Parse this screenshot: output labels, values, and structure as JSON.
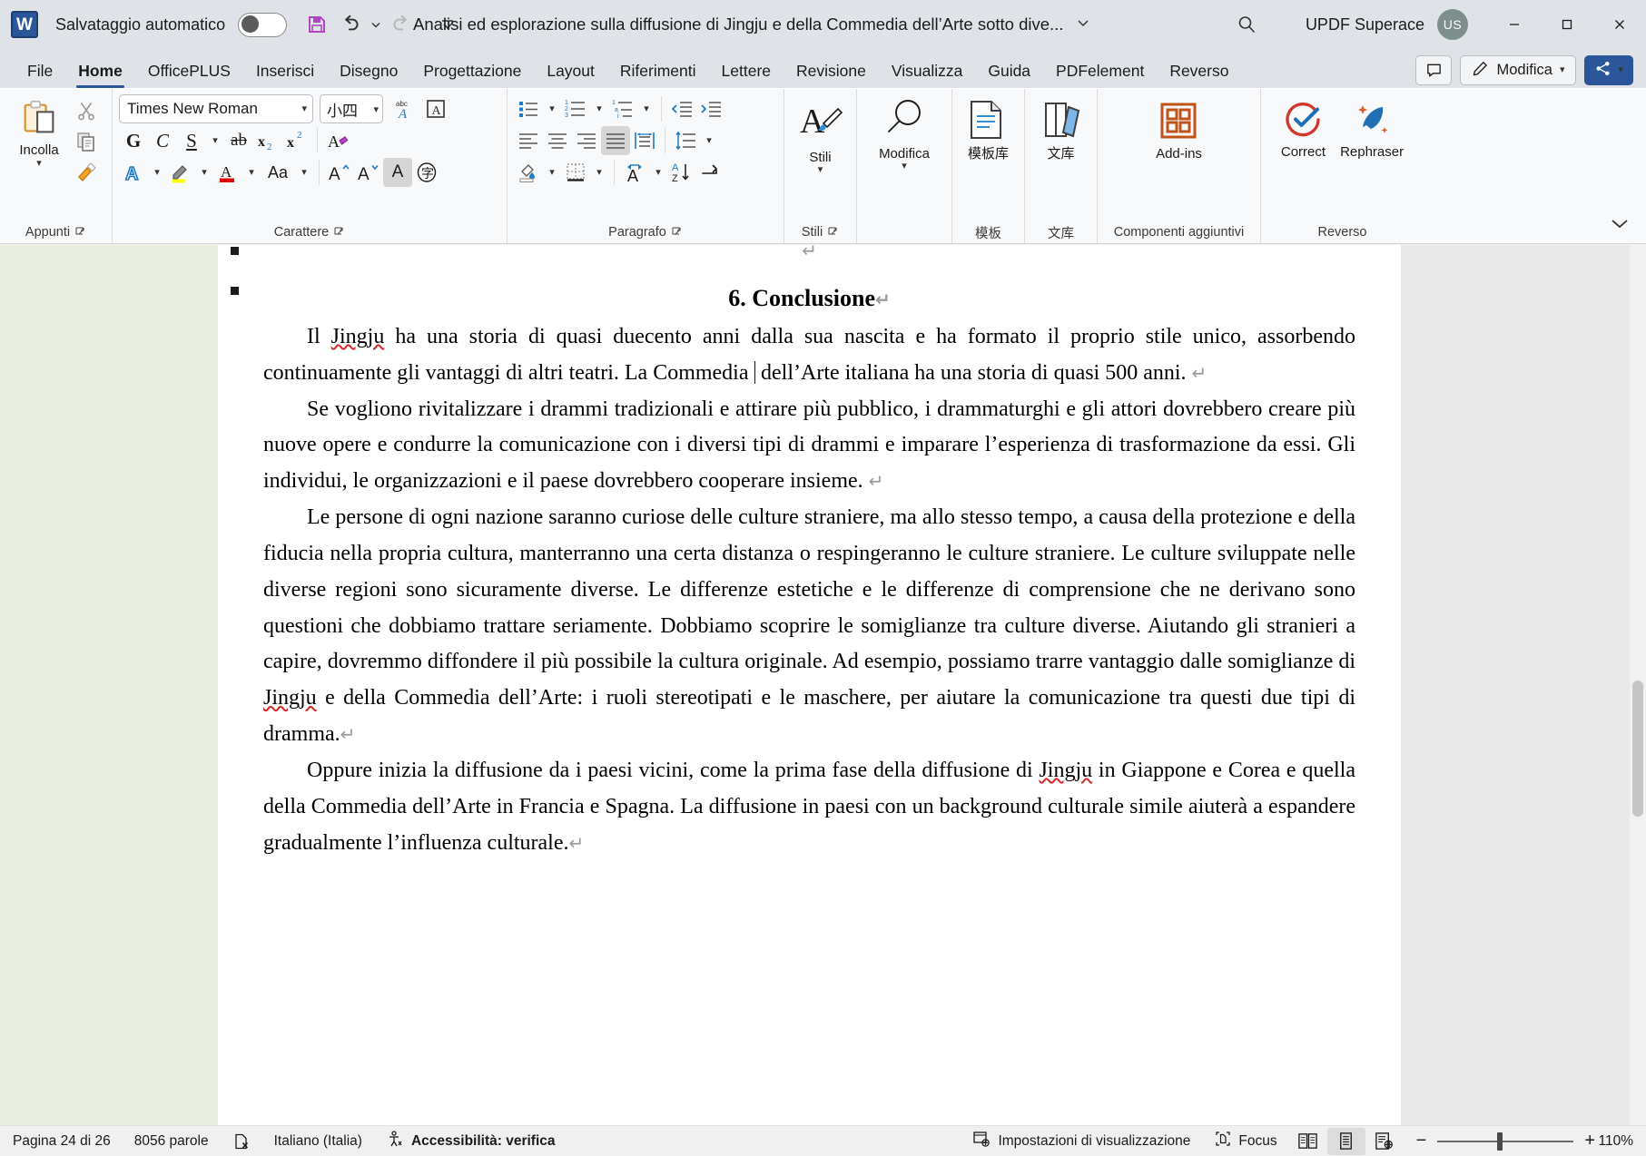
{
  "titlebar": {
    "app_icon": "word-icon",
    "autosave_label": "Salvataggio automatico",
    "autosave_state": "off",
    "quick_access": [
      {
        "name": "save-icon",
        "label": "Salva"
      },
      {
        "name": "undo-icon",
        "label": "Annulla"
      },
      {
        "name": "redo-icon",
        "label": "Ripeti"
      },
      {
        "name": "customize-qat-icon",
        "label": "Personalizza barra di accesso rapido"
      }
    ],
    "document_title": "Analisi ed esplorazione sulla diffusione di Jingju e della Commedia dell’Arte sotto dive...",
    "search_icon": "search-icon",
    "account_name": "UPDF Superace",
    "avatar_initials": "US",
    "window_controls": [
      "minimize",
      "maximize",
      "close"
    ]
  },
  "tabs": [
    {
      "label": "File",
      "active": false
    },
    {
      "label": "Home",
      "active": true
    },
    {
      "label": "OfficePLUS",
      "active": false
    },
    {
      "label": "Inserisci",
      "active": false
    },
    {
      "label": "Disegno",
      "active": false
    },
    {
      "label": "Progettazione",
      "active": false
    },
    {
      "label": "Layout",
      "active": false
    },
    {
      "label": "Riferimenti",
      "active": false
    },
    {
      "label": "Lettere",
      "active": false
    },
    {
      "label": "Revisione",
      "active": false
    },
    {
      "label": "Visualizza",
      "active": false
    },
    {
      "label": "Guida",
      "active": false
    },
    {
      "label": "PDFelement",
      "active": false
    },
    {
      "label": "Reverso",
      "active": false
    }
  ],
  "tabbar_right": {
    "comment_icon": "comment-icon",
    "edit_mode_label": "Modifica",
    "edit_mode_icon": "pencil-icon",
    "share_icon": "share-icon"
  },
  "ribbon": {
    "groups": [
      {
        "name": "clipboard",
        "label": "Appunti",
        "has_dialog_launcher": true,
        "paste_label": "Incolla",
        "buttons": [
          "cut-icon",
          "copy-icon",
          "format-painter-icon"
        ]
      },
      {
        "name": "font",
        "label": "Carattere",
        "has_dialog_launcher": true,
        "font_name": "Times New Roman",
        "font_size": "小四",
        "buttons": [
          "bold-G",
          "italic-C",
          "underline-S",
          "strikethrough-ab",
          "subscript-x2",
          "superscript-x2",
          "clear-formatting-icon",
          "text-effects-icon",
          "highlight-icon",
          "font-color-icon",
          "change-case-Aa",
          "grow-font-icon",
          "shrink-font-icon",
          "character-shading-icon",
          "enclose-character-icon",
          "phonetic-guide-icon",
          "character-border-icon"
        ]
      },
      {
        "name": "paragraph",
        "label": "Paragrafo",
        "has_dialog_launcher": true,
        "buttons": [
          "bullets-icon",
          "numbering-icon",
          "multilevel-list-icon",
          "decrease-indent-icon",
          "increase-indent-icon",
          "align-left-icon",
          "align-center-icon",
          "align-right-icon",
          "justify-icon",
          "distribute-icon",
          "line-spacing-icon",
          "shading-icon",
          "borders-icon",
          "asian-layout-icon",
          "sort-icon",
          "show-formatting-marks-icon"
        ],
        "active_button": "justify-icon"
      },
      {
        "name": "styles",
        "label": "Stili",
        "has_dialog_launcher": true,
        "button_label": "Stili"
      },
      {
        "name": "editing",
        "label": "",
        "has_dialog_launcher": false,
        "button_label": "Modifica"
      },
      {
        "name": "template",
        "label": "模板",
        "has_dialog_launcher": false,
        "button_label": "模板库"
      },
      {
        "name": "library",
        "label": "文库",
        "has_dialog_launcher": false,
        "button_label": "文库"
      },
      {
        "name": "addins",
        "label": "Componenti aggiuntivi",
        "has_dialog_launcher": false,
        "button_label": "Add-ins"
      },
      {
        "name": "reverso",
        "label": "Reverso",
        "has_dialog_launcher": false,
        "buttons": [
          {
            "label": "Correct",
            "icon": "check-circle-icon"
          },
          {
            "label": "Rephraser",
            "icon": "feather-icon"
          }
        ]
      }
    ],
    "collapse_icon": "chevron-up-icon"
  },
  "document": {
    "heading": "6. Conclusione",
    "paragraphs": [
      {
        "segments": [
          {
            "t": "Il ",
            "mis": false
          },
          {
            "t": "Jingju",
            "mis": true
          },
          {
            "t": " ha una storia di quasi duecento anni dalla sua nascita e ha formato il proprio stile unico, assorbendo continuamente gli vantaggi di altri teatri. La Commedia dell’Arte italiana ha una storia di quasi 500 anni. ",
            "mis": false
          }
        ],
        "caret_after_line": 2,
        "ends_with_pilcrow": true
      },
      {
        "segments": [
          {
            "t": "Se vogliono rivitalizzare i drammi tradizionali e attirare più pubblico, i drammaturghi e gli attori dovrebbero creare più nuove opere e condurre la comunicazione con i diversi tipi di drammi e imparare l’esperienza di trasformazione da essi. Gli individui, le organizzazioni e il paese dovrebbero cooperare insieme. ",
            "mis": false
          }
        ],
        "ends_with_pilcrow": true
      },
      {
        "segments": [
          {
            "t": "Le persone di ogni nazione saranno curiose delle culture straniere, ma allo stesso tempo, a causa della protezione e della fiducia nella propria cultura, manterranno una certa distanza o respingeranno le culture straniere. Le culture sviluppate nelle diverse regioni sono sicuramente diverse. Le differenze estetiche e le differenze di comprensione che ne derivano sono questioni che dobbiamo trattare seriamente. Dobbiamo scoprire le somiglianze tra culture diverse. Aiutando gli stranieri a capire, dovremmo diffondere il più possibile la cultura originale. Ad esempio, possiamo trarre vantaggio dalle somiglianze di ",
            "mis": false
          },
          {
            "t": "Jingju",
            "mis": true
          },
          {
            "t": " e della Commedia dell’Arte: i ruoli stereotipati e le maschere, per aiutare la comunicazione tra questi due tipi di dramma.",
            "mis": false
          }
        ],
        "ends_with_pilcrow": true
      },
      {
        "segments": [
          {
            "t": "Oppure inizia la diffusione da i paesi vicini, come la prima fase della diffusione di ",
            "mis": false
          },
          {
            "t": "Jingju",
            "mis": true
          },
          {
            "t": " in Giappone e Corea e quella della Commedia dell’Arte in Francia e Spagna. La diffusione in paesi con un background culturale simile aiuterà a espandere gradualmente l’influenza culturale.",
            "mis": false
          }
        ],
        "ends_with_pilcrow": true
      }
    ],
    "pilcrow_glyph": "↵",
    "object_anchor_icon": "object-anchor-marker"
  },
  "statusbar": {
    "page_info": "Pagina 24 di 26",
    "word_count": "8056 parole",
    "proofing_icon": "proofing-errors-icon",
    "language": "Italiano (Italia)",
    "accessibility_icon": "accessibility-icon",
    "accessibility_label": "Accessibilità: verifica",
    "display_settings_icon": "display-settings-icon",
    "display_settings_label": "Impostazioni di visualizzazione",
    "focus_icon": "focus-icon",
    "focus_label": "Focus",
    "views": [
      {
        "name": "read-mode-icon",
        "active": false
      },
      {
        "name": "print-layout-icon",
        "active": true
      },
      {
        "name": "web-layout-icon",
        "active": false
      }
    ],
    "zoom_out_label": "−",
    "zoom_in_label": "+",
    "zoom_level": "110%"
  },
  "colors": {
    "accent": "#2b579a",
    "titlebar_bg": "#dfe3e8",
    "ribbon_bg": "#f8f9fa",
    "page_bg": "#ffffff",
    "canvas_bg": "#e8e8e8",
    "left_pane_bg": "#e9eee0",
    "avatar_bg": "#7d8f8d",
    "highlight_yellow": "#ffff00",
    "font_color_red": "#e00000",
    "addins_orange": "#c1531a",
    "correct_red": "#d1392c",
    "rephraser_blue": "#1f6fb5"
  }
}
